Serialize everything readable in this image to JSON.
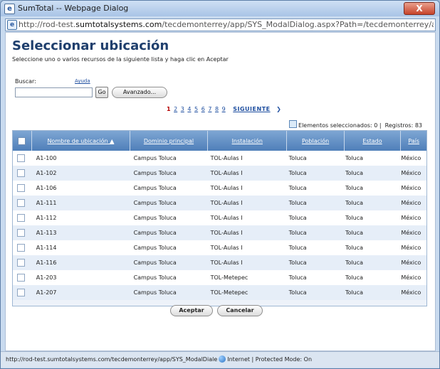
{
  "window": {
    "title": "SumTotal -- Webpage Dialog",
    "close_label": "X",
    "address_prefix": "http://rod-test.",
    "address_host": "sumtotalsystems.com",
    "address_path": "/tecdemonterrey/app/SYS_ModalDialog.aspx?Path=/tecdemonterrey/app/administration/asset/resource/AD"
  },
  "header": {
    "title": "Seleccionar ubicación",
    "subtitle": "Seleccione uno o varios recursos de la siguiente lista y haga clic en Aceptar"
  },
  "search": {
    "label": "Buscar:",
    "help_link": "Ayuda",
    "value": "",
    "go_label": "Go",
    "advanced_label": "Avanzado..."
  },
  "pagination": {
    "pages": [
      "1",
      "2",
      "3",
      "4",
      "5",
      "6",
      "7",
      "8",
      "9"
    ],
    "current": "1",
    "next_label": "SIGUIENTE",
    "next_arrow": "❯"
  },
  "status": {
    "selected_text": "Elementos seleccionados: 0 |",
    "records_text": "Registros: 83"
  },
  "table": {
    "columns": [
      "Nombre de ubicación ▲",
      "Dominio principal",
      "Instalación",
      "Población",
      "Estado",
      "País"
    ],
    "rows": [
      [
        "A1-100",
        "Campus Toluca",
        "TOL-Aulas I",
        "Toluca",
        "Toluca",
        "México"
      ],
      [
        "A1-102",
        "Campus Toluca",
        "TOL-Aulas I",
        "Toluca",
        "Toluca",
        "México"
      ],
      [
        "A1-106",
        "Campus Toluca",
        "TOL-Aulas I",
        "Toluca",
        "Toluca",
        "México"
      ],
      [
        "A1-111",
        "Campus Toluca",
        "TOL-Aulas I",
        "Toluca",
        "Toluca",
        "México"
      ],
      [
        "A1-112",
        "Campus Toluca",
        "TOL-Aulas I",
        "Toluca",
        "Toluca",
        "México"
      ],
      [
        "A1-113",
        "Campus Toluca",
        "TOL-Aulas I",
        "Toluca",
        "Toluca",
        "México"
      ],
      [
        "A1-114",
        "Campus Toluca",
        "TOL-Aulas I",
        "Toluca",
        "Toluca",
        "México"
      ],
      [
        "A1-116",
        "Campus Toluca",
        "TOL-Aulas I",
        "Toluca",
        "Toluca",
        "México"
      ],
      [
        "A1-203",
        "Campus Toluca",
        "TOL-Metepec",
        "Toluca",
        "Toluca",
        "México"
      ],
      [
        "A1-207",
        "Campus Toluca",
        "TOL-Metepec",
        "Toluca",
        "Toluca",
        "México"
      ]
    ]
  },
  "actions": {
    "accept_label": "Aceptar",
    "cancel_label": "Cancelar"
  },
  "statusbar": {
    "url": "http://rod-test.sumtotalsystems.com/tecdemonterrey/app/SYS_ModalDiale",
    "zone": "Internet | Protected Mode: On"
  },
  "colors": {
    "header_blue": "#4f7fb9",
    "title_blue": "#1f3f6d",
    "link_blue": "#1f4fa0",
    "current_page_red": "#b50000",
    "row_alt": "#e6eef8"
  }
}
